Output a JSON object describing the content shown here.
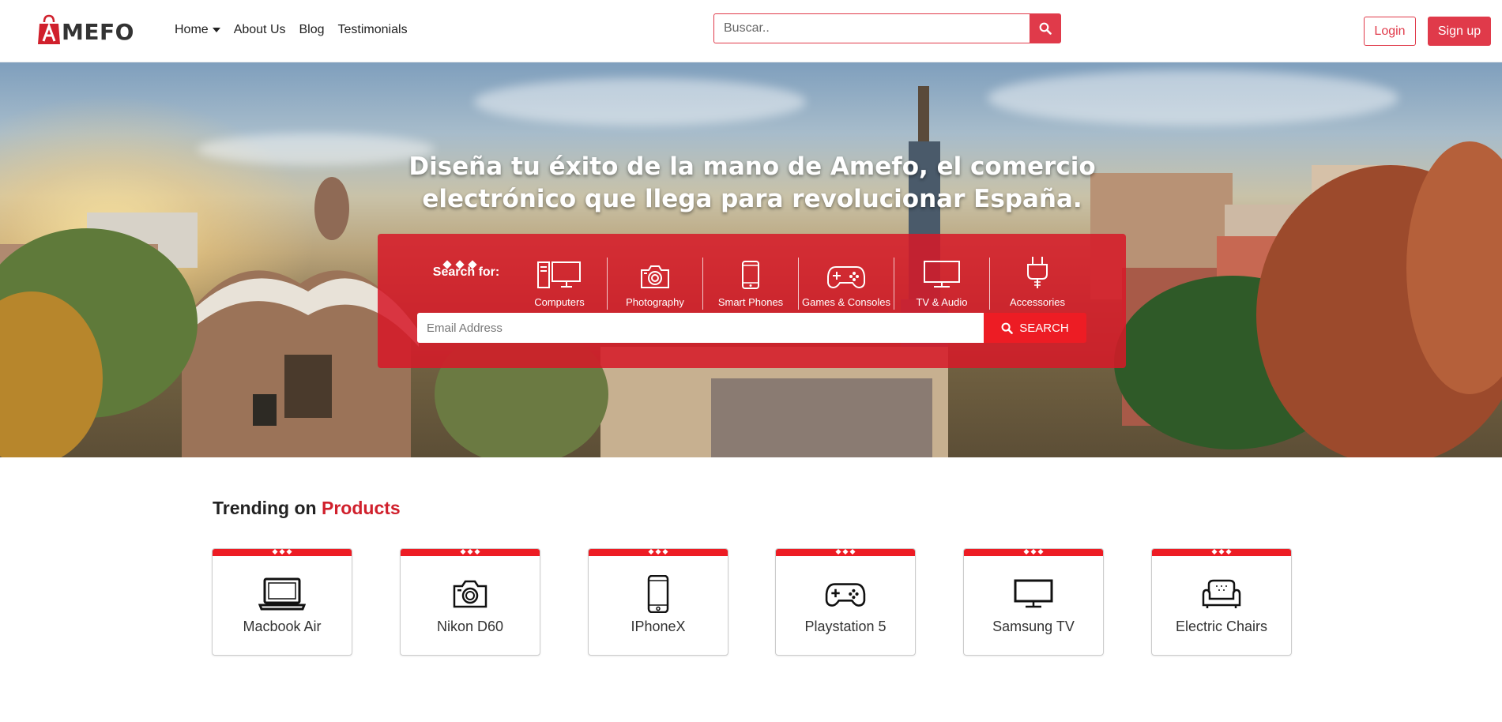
{
  "brand": {
    "logo_text": "MEFO"
  },
  "nav": {
    "items": [
      {
        "label": "Home",
        "dropdown": true
      },
      {
        "label": "About Us"
      },
      {
        "label": "Blog"
      },
      {
        "label": "Testimonials"
      }
    ]
  },
  "top_search": {
    "placeholder": "Buscar.."
  },
  "auth": {
    "login_label": "Login",
    "signup_label": "Sign up"
  },
  "hero": {
    "title_line1": "Diseña tu éxito de la mano de Amefo, el comercio",
    "title_line2": "electrónico que llega para revolucionar España.",
    "search_for_label": "Search for:",
    "categories": [
      {
        "label": "Computers",
        "icon": "computer-icon"
      },
      {
        "label": "Photography",
        "icon": "camera-icon"
      },
      {
        "label": "Smart Phones",
        "icon": "smartphone-icon"
      },
      {
        "label": "Games & Consoles",
        "icon": "gamepad-icon"
      },
      {
        "label": "TV & Audio",
        "icon": "tv-icon"
      },
      {
        "label": "Accessories",
        "icon": "plug-icon"
      }
    ],
    "input_placeholder": "Email Address",
    "search_button_label": "SEARCH"
  },
  "trending": {
    "title_prefix": "Trending on ",
    "title_accent": "Products",
    "products": [
      {
        "label": "Macbook Air",
        "icon": "laptop-icon"
      },
      {
        "label": "Nikon D60",
        "icon": "camera-icon"
      },
      {
        "label": "IPhoneX",
        "icon": "smartphone-icon"
      },
      {
        "label": "Playstation 5",
        "icon": "gamepad-icon"
      },
      {
        "label": "Samsung TV",
        "icon": "tv-icon"
      },
      {
        "label": "Electric Chairs",
        "icon": "sofa-icon"
      }
    ]
  },
  "colors": {
    "accent": "#e03a4a",
    "panel_red": "#d61828",
    "button_red": "#ed1c24"
  }
}
